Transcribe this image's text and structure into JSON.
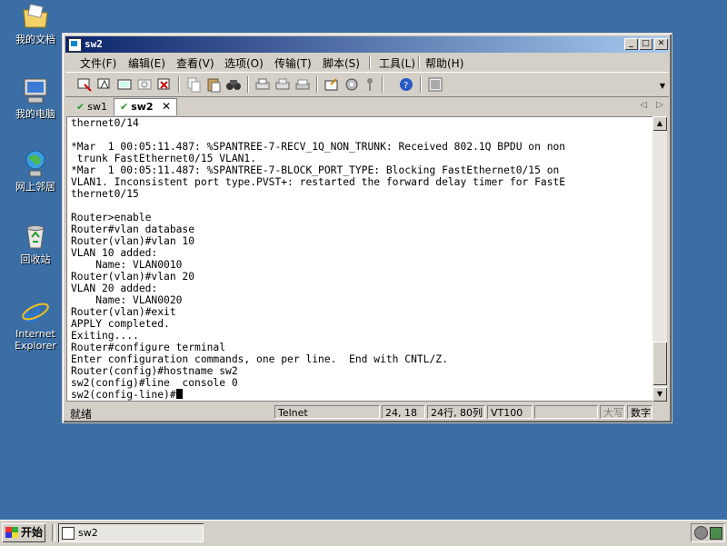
{
  "desktop": {
    "icons": [
      {
        "label": "我的文档",
        "icon": "my-documents-icon"
      },
      {
        "label": "我的电脑",
        "icon": "my-computer-icon"
      },
      {
        "label": "网上邻居",
        "icon": "network-places-icon"
      },
      {
        "label": "回收站",
        "icon": "recycle-bin-icon"
      },
      {
        "label": "Internet Explorer",
        "icon": "internet-explorer-icon"
      }
    ]
  },
  "window": {
    "title": "sw2",
    "menu": [
      "文件(F)",
      "编辑(E)",
      "查看(V)",
      "选项(O)",
      "传输(T)",
      "脚本(S)",
      "工具(L)",
      "帮助(H)"
    ],
    "tabs": [
      {
        "label": "sw1",
        "active": false
      },
      {
        "label": "sw2",
        "active": true
      }
    ],
    "tab_close": "✕",
    "terminal_lines": [
      "thernet0/14",
      "",
      "*Mar  1 00:05:11.487: %SPANTREE-7-RECV_1Q_NON_TRUNK: Received 802.1Q BPDU on non",
      " trunk FastEthernet0/15 VLAN1.",
      "*Mar  1 00:05:11.487: %SPANTREE-7-BLOCK_PORT_TYPE: Blocking FastEthernet0/15 on",
      "VLAN1. Inconsistent port type.PVST+: restarted the forward delay timer for FastE",
      "thernet0/15",
      "",
      "Router>enable",
      "Router#vlan database",
      "Router(vlan)#vlan 10",
      "VLAN 10 added:",
      "    Name: VLAN0010",
      "Router(vlan)#vlan 20",
      "VLAN 20 added:",
      "    Name: VLAN0020",
      "Router(vlan)#exit",
      "APPLY completed.",
      "Exiting....",
      "Router#configure terminal",
      "Enter configuration commands, one per line.  End with CNTL/Z.",
      "Router(config)#hostname sw2",
      "sw2(config)#line  console 0",
      "sw2(config-line)#"
    ],
    "status": {
      "ready": "就绪",
      "protocol": "Telnet",
      "cursor_pos": "24, 18",
      "size": "24行, 80列",
      "emulation": "VT100",
      "blank": "",
      "caps": "大写",
      "num": "数字"
    }
  },
  "taskbar": {
    "start_label": "开始",
    "task_label": "sw2"
  },
  "colors": {
    "desktop": "#3a6ea5",
    "title_start": "#0a246a",
    "title_end": "#a6caf0",
    "chrome": "#d4d0c8"
  }
}
